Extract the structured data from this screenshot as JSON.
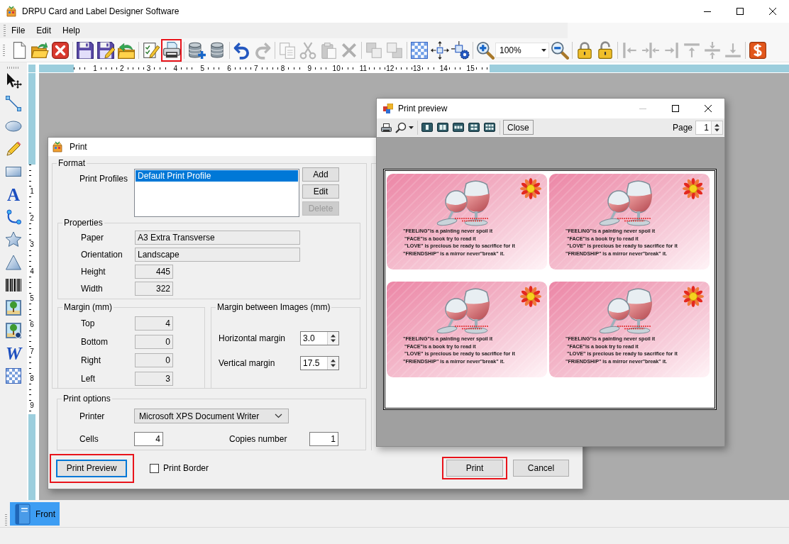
{
  "window": {
    "title": "DRPU Card and Label Designer Software"
  },
  "menu": [
    {
      "label": "File"
    },
    {
      "label": "Edit"
    },
    {
      "label": "Help"
    }
  ],
  "toolbar": {
    "items": [
      {
        "kind": "button",
        "disabled": false,
        "highlighted": false
      },
      {
        "kind": "button",
        "disabled": false,
        "highlighted": false
      },
      {
        "kind": "button",
        "disabled": false,
        "highlighted": false
      },
      {
        "kind": "separator"
      },
      {
        "kind": "button",
        "disabled": false,
        "highlighted": false
      },
      {
        "kind": "button",
        "disabled": false,
        "highlighted": false
      },
      {
        "kind": "button",
        "disabled": false,
        "highlighted": false
      },
      {
        "kind": "separator"
      },
      {
        "kind": "button",
        "disabled": false,
        "highlighted": false
      },
      {
        "kind": "button",
        "disabled": false,
        "highlighted": true
      },
      {
        "kind": "separator"
      },
      {
        "kind": "button",
        "disabled": false,
        "highlighted": false
      },
      {
        "kind": "button",
        "disabled": false,
        "highlighted": false
      },
      {
        "kind": "separator"
      },
      {
        "kind": "button",
        "disabled": false,
        "highlighted": false
      },
      {
        "kind": "button",
        "disabled": true,
        "highlighted": false
      },
      {
        "kind": "separator"
      },
      {
        "kind": "button",
        "disabled": true,
        "highlighted": false
      },
      {
        "kind": "button",
        "disabled": true,
        "highlighted": false
      },
      {
        "kind": "button",
        "disabled": true,
        "highlighted": false
      },
      {
        "kind": "button",
        "disabled": true,
        "highlighted": false
      },
      {
        "kind": "separator"
      },
      {
        "kind": "button",
        "disabled": true,
        "highlighted": false
      },
      {
        "kind": "button",
        "disabled": true,
        "highlighted": false
      },
      {
        "kind": "separator"
      },
      {
        "kind": "button",
        "disabled": false,
        "highlighted": false
      },
      {
        "kind": "button",
        "disabled": false,
        "highlighted": false
      },
      {
        "kind": "button",
        "disabled": false,
        "highlighted": false
      },
      {
        "kind": "separator"
      },
      {
        "kind": "button",
        "disabled": false,
        "highlighted": false
      },
      {
        "kind": "combo",
        "value": "100%"
      },
      {
        "kind": "button",
        "disabled": false,
        "highlighted": false
      },
      {
        "kind": "separator"
      },
      {
        "kind": "button",
        "disabled": false,
        "highlighted": false
      },
      {
        "kind": "button",
        "disabled": false,
        "highlighted": false
      },
      {
        "kind": "separator"
      },
      {
        "kind": "button",
        "disabled": true,
        "highlighted": false
      },
      {
        "kind": "button",
        "disabled": true,
        "highlighted": false
      },
      {
        "kind": "button",
        "disabled": true,
        "highlighted": false
      },
      {
        "kind": "button",
        "disabled": true,
        "highlighted": false
      },
      {
        "kind": "button",
        "disabled": true,
        "highlighted": false
      },
      {
        "kind": "button",
        "disabled": true,
        "highlighted": false
      },
      {
        "kind": "separator"
      },
      {
        "kind": "button",
        "disabled": false,
        "highlighted": false
      }
    ]
  },
  "rulers": {
    "horizontal": [
      "1",
      "2",
      "3",
      "4",
      "5",
      "6",
      "7",
      "8",
      "9",
      "10",
      "11",
      "12",
      "13",
      "14",
      "15"
    ],
    "vertical": [
      "1",
      "2",
      "3",
      "4",
      "5",
      "6",
      "7",
      "8",
      "9"
    ]
  },
  "toolbox": [
    {
      "kind": "icon"
    },
    {
      "kind": "icon"
    },
    {
      "kind": "icon"
    },
    {
      "kind": "icon"
    },
    {
      "kind": "icon"
    },
    {
      "kind": "text_glyph",
      "glyph": "A"
    },
    {
      "kind": "icon"
    },
    {
      "kind": "icon"
    },
    {
      "kind": "icon"
    },
    {
      "kind": "icon"
    },
    {
      "kind": "icon"
    },
    {
      "kind": "icon"
    },
    {
      "kind": "wordart_glyph",
      "glyph": "W"
    },
    {
      "kind": "icon"
    }
  ],
  "print_dialog": {
    "title": "Print",
    "format": {
      "legend": "Format",
      "profiles_label": "Print Profiles",
      "profiles": [
        {
          "label": "Default Print Profile",
          "selected": true
        }
      ],
      "buttons": [
        {
          "label": "Add",
          "disabled": false
        },
        {
          "label": "Edit",
          "disabled": false
        },
        {
          "label": "Delete",
          "disabled": true
        }
      ]
    },
    "properties": {
      "legend": "Properties",
      "fields": [
        {
          "label": "Paper",
          "value": "A3 Extra Transverse",
          "kind": "text",
          "readonly": true
        },
        {
          "label": "Orientation",
          "value": "Landscape",
          "kind": "text",
          "readonly": true
        },
        {
          "label": "Height",
          "value": "445",
          "kind": "number",
          "readonly": true
        },
        {
          "label": "Width",
          "value": "322",
          "kind": "number",
          "readonly": true
        }
      ]
    },
    "margin": {
      "legend": "Margin (mm)",
      "fields": [
        {
          "label": "Top",
          "value": "4",
          "readonly": true
        },
        {
          "label": "Bottom",
          "value": "0",
          "readonly": true
        },
        {
          "label": "Right",
          "value": "0",
          "readonly": true
        },
        {
          "label": "Left",
          "value": "3",
          "readonly": true
        }
      ]
    },
    "image_margin": {
      "legend": "Margin between Images (mm)",
      "fields": [
        {
          "label": "Horizontal margin",
          "value": "3.0",
          "readonly": false
        },
        {
          "label": "Vertical margin",
          "value": "17.5",
          "readonly": false
        }
      ]
    },
    "print_options": {
      "legend": "Print options",
      "printer": {
        "label": "Printer",
        "value": "Microsoft XPS Document Writer"
      },
      "cells": {
        "label": "Cells",
        "value": "4",
        "readonly": false
      },
      "copies": {
        "label": "Copies number",
        "value": "1",
        "readonly": false
      }
    },
    "preview_button": {
      "label": "Print Preview",
      "focused": true,
      "highlighted": true
    },
    "print_border": {
      "label": "Print Border",
      "checked": false
    },
    "buttons": [
      {
        "label": "Print",
        "highlighted": true
      },
      {
        "label": "Cancel",
        "highlighted": false
      }
    ]
  },
  "print_preview": {
    "title": "Print preview",
    "minimize": {
      "disabled": true
    },
    "close_label": "Close",
    "page_label": "Page",
    "page_value": "1",
    "cards": [
      {
        "lines": [
          "\"FEELiNG\"is a painting never spoil it",
          " \"FACE\"is a book try to read it",
          " \"LOVE\" is precious be ready to sacrifice for it",
          "\"FRiENDSHiP\" is a mirror never\"break\" it."
        ]
      },
      {
        "lines": [
          "\"FEELiNG\"is a painting never spoil it",
          " \"FACE\"is a book try to read it",
          " \"LOVE\" is precious be ready to sacrifice for it",
          "\"FRiENDSHiP\" is a mirror never\"break\" it."
        ]
      },
      {
        "lines": [
          "\"FEELiNG\"is a painting never spoil it",
          " \"FACE\"is a book try to read it",
          " \"LOVE\" is precious be ready to sacrifice for it",
          "\"FRiENDSHiP\" is a mirror never\"break\" it."
        ]
      },
      {
        "lines": [
          "\"FEELiNG\"is a painting never spoil it",
          " \"FACE\"is a book try to read it",
          " \"LOVE\" is precious be ready to sacrifice for it",
          "\"FRiENDSHiP\" is a mirror never\"break\" it."
        ]
      }
    ]
  },
  "tabs": [
    {
      "label": "Front",
      "selected": true
    }
  ]
}
